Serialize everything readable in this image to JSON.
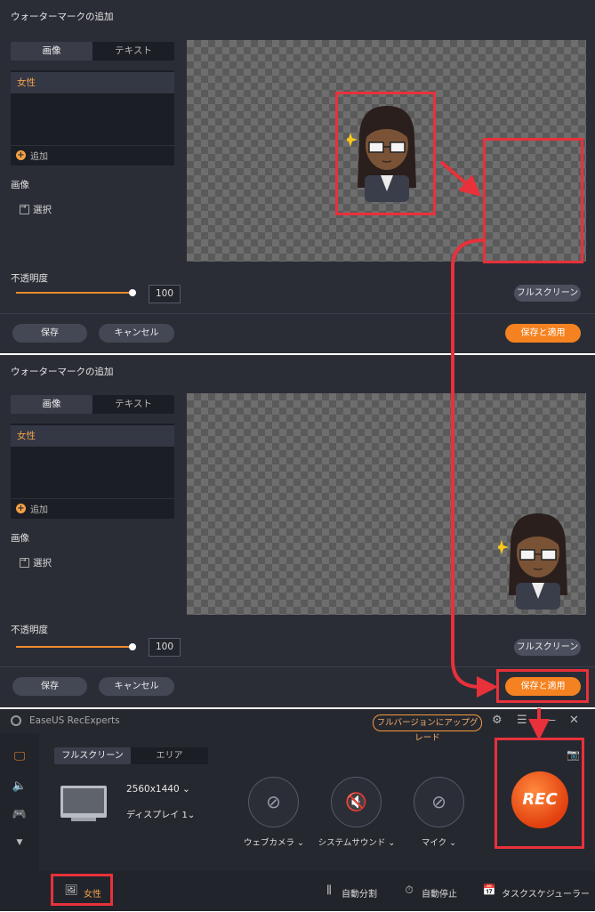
{
  "watermark": {
    "title": "ウォーターマークの追加",
    "tabs": [
      {
        "label": "画像",
        "active": true
      },
      {
        "label": "テキスト",
        "active": false
      }
    ],
    "list_item": "女性",
    "add_label": "追加",
    "image_label": "画像",
    "select_label": "選択",
    "opacity_label": "不透明度",
    "opacity_value": "100",
    "opacity_fraction": 1.0,
    "fullscreen_label": "フルスクリーン",
    "save_label": "保存",
    "cancel_label": "キャンセル",
    "save_apply_label": "保存と適用"
  },
  "app": {
    "title": "EaseUS RecExperts",
    "upgrade_label": "フルバージョンにアップグレード",
    "mode_tabs": [
      {
        "label": "フルスクリーン",
        "active": true
      },
      {
        "label": "エリア",
        "active": false
      }
    ],
    "resolution": "2560x1440",
    "display": "ディスプレイ 1",
    "toggles": [
      {
        "label": "ウェブカメラ",
        "icon": "webcam-off-icon"
      },
      {
        "label": "システムサウンド",
        "icon": "speaker-off-icon"
      },
      {
        "label": "マイク",
        "icon": "mic-off-icon"
      }
    ],
    "rec_label": "REC",
    "sidebar_count": "2",
    "watermark_name": "女性",
    "bottom_items": [
      "自動分割",
      "自動停止",
      "タスクスケジューラー"
    ]
  },
  "colors": {
    "accent": "#f58220",
    "annotation_red": "#e8313a",
    "panel_bg": "#2b2d36",
    "selected_text": "#f3a24a"
  }
}
